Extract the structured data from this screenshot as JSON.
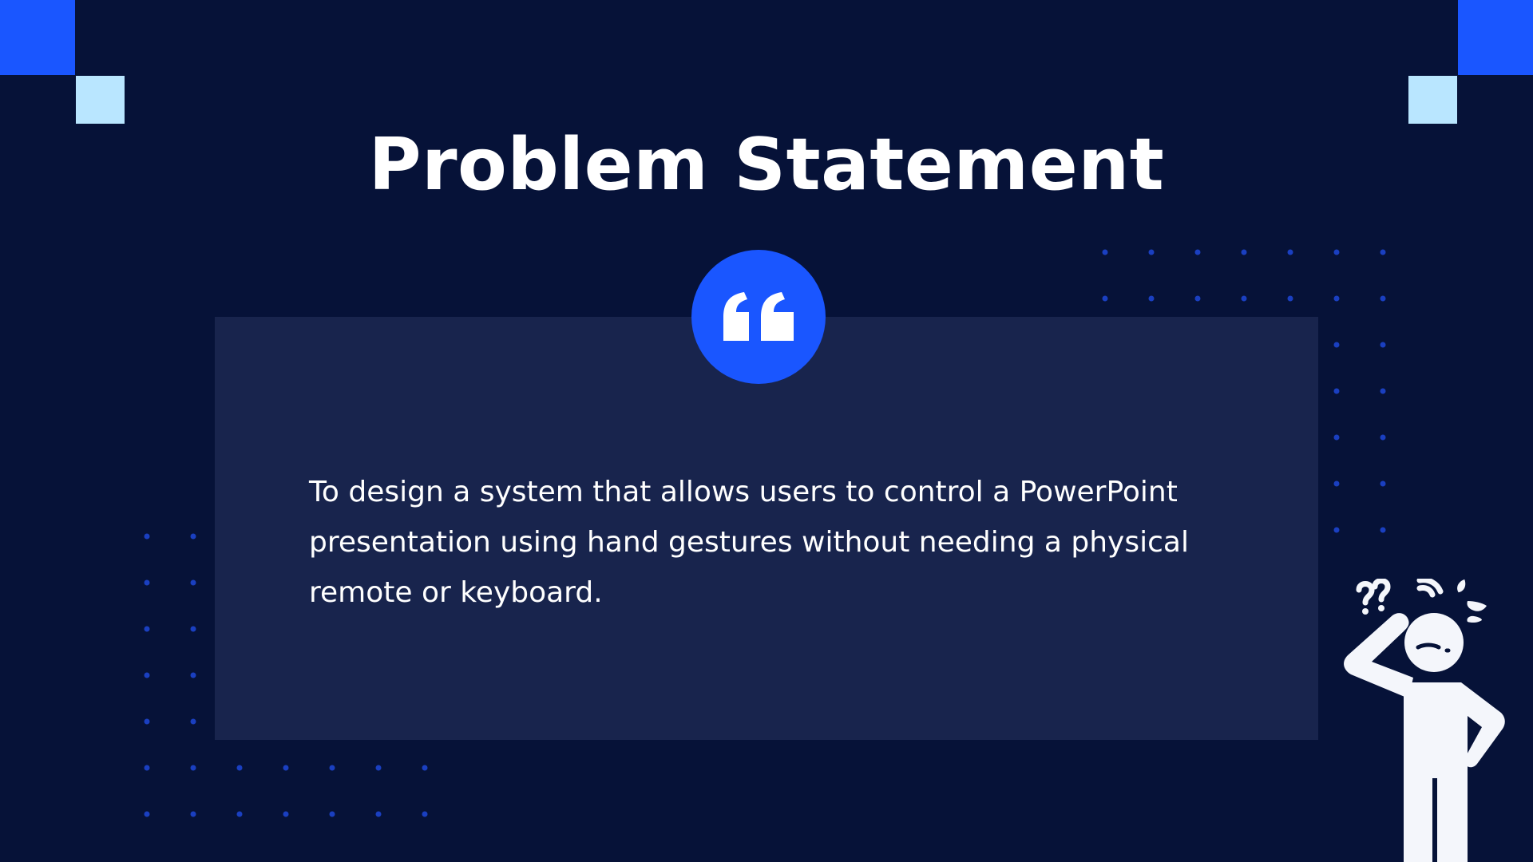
{
  "slide": {
    "title": "Problem Statement",
    "quote_icon": "quote-icon",
    "body_text": "To design a system that allows users to control a PowerPoint presentation using hand gestures without needing a physical remote or keyboard.",
    "illustration_icon": "confused-person-icon"
  },
  "colors": {
    "background": "#061238",
    "card": "#18244d",
    "accent_blue": "#1a56ff",
    "accent_light": "#b9e6ff",
    "dots": "#1a3fc0",
    "text": "#ffffff",
    "figure": "#f4f6fb"
  }
}
